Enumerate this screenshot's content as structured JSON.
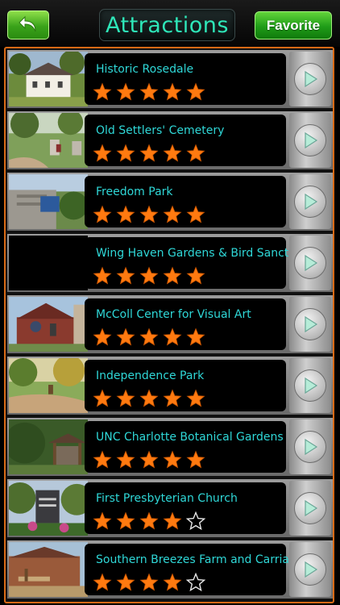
{
  "header": {
    "back_icon": "back-arrow-icon",
    "title": "Attractions",
    "favorite_label": "Favorite"
  },
  "colors": {
    "accent_cyan": "#2fd7d7",
    "title_green": "#2ee6b8",
    "button_green": "#3aa21a",
    "list_border": "#d86a16",
    "star_orange": "#ff7a10"
  },
  "attractions": [
    {
      "name": "Historic Rosedale",
      "rating": 5,
      "thumb": "house"
    },
    {
      "name": "Old Settlers' Cemetery",
      "rating": 5,
      "thumb": "cemetery"
    },
    {
      "name": "Freedom Park",
      "rating": 5,
      "thumb": "sign"
    },
    {
      "name": "Wing Haven Gardens & Bird Sanctuary",
      "rating": 5,
      "thumb": "none"
    },
    {
      "name": "McColl Center for Visual Art",
      "rating": 5,
      "thumb": "church"
    },
    {
      "name": "Independence Park",
      "rating": 5,
      "thumb": "park"
    },
    {
      "name": "UNC Charlotte Botanical Gardens",
      "rating": 5,
      "thumb": "garden"
    },
    {
      "name": "First Presbyterian Church",
      "rating": 4,
      "thumb": "monument"
    },
    {
      "name": "Southern Breezes Farm and Carriages",
      "rating": 4,
      "thumb": "farm"
    }
  ]
}
